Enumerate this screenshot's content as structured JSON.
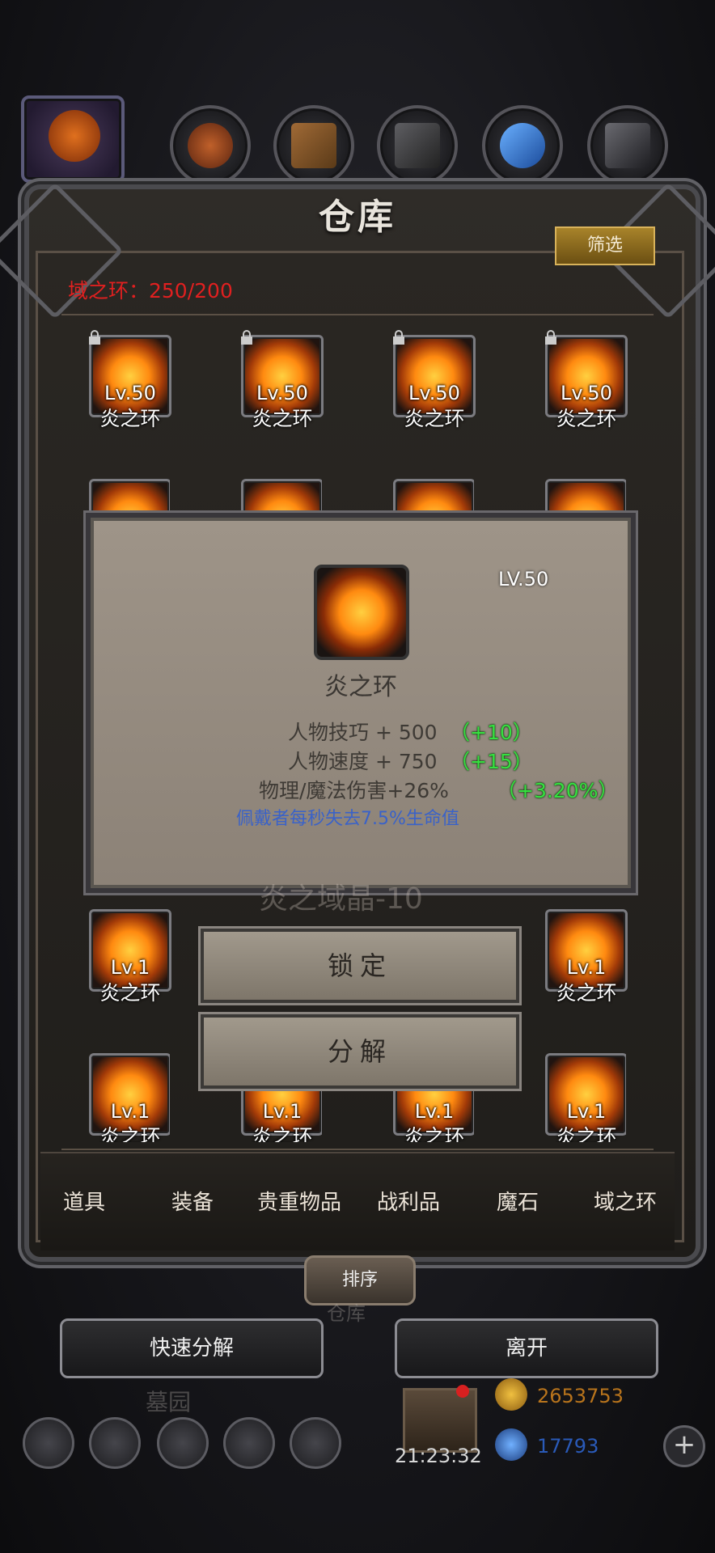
{
  "header": {
    "title": "仓库",
    "filter_label": "筛选",
    "count_label": "域之环：250/200"
  },
  "top_categories": [
    {
      "name": "pumpkin-category",
      "color": "#c0501a"
    },
    {
      "name": "potion-category",
      "color": "#9a4a20"
    },
    {
      "name": "wood-category",
      "color": "#8a5a2e"
    },
    {
      "name": "iron-category",
      "color": "#4a4a4a"
    },
    {
      "name": "crystal-category",
      "color": "#2a7ad0"
    },
    {
      "name": "ore-category",
      "color": "#5a5a5e"
    }
  ],
  "items_row1": [
    {
      "level": "Lv.50",
      "name": "炎之环",
      "locked": true
    },
    {
      "level": "Lv.50",
      "name": "炎之环",
      "locked": true
    },
    {
      "level": "Lv.50",
      "name": "炎之环",
      "locked": true
    },
    {
      "level": "Lv.50",
      "name": "炎之环",
      "locked": true
    }
  ],
  "items_row3": [
    {
      "level": "Lv.1",
      "name": "炎之环"
    },
    {
      "level": "Lv.1",
      "name": "炎之环"
    }
  ],
  "items_row4": [
    {
      "level": "Lv.1",
      "name": "炎之环"
    },
    {
      "level": "Lv.1",
      "name": "炎之环"
    },
    {
      "level": "Lv.1",
      "name": "炎之环"
    },
    {
      "level": "Lv.1",
      "name": "炎之环"
    }
  ],
  "popup": {
    "level": "LV.50",
    "item_name": "炎之环",
    "stats": [
      {
        "label": "人物技巧 + 500",
        "bonus": "（+10）"
      },
      {
        "label": "人物速度 + 750",
        "bonus": "（+15）"
      },
      {
        "label": "物理/魔法伤害+26%",
        "bonus": "（+3.20%）"
      }
    ],
    "effect": "佩戴者每秒失去7.5%生命值",
    "background_text": "炎之域晶-10"
  },
  "actions": {
    "lock_label": "锁定",
    "decompose_label": "分解"
  },
  "tabs": [
    "道具",
    "装备",
    "贵重物品",
    "战利品",
    "魔石",
    "域之环"
  ],
  "sort_label": "排序",
  "bottom_buttons": {
    "quick_decompose": "快速分解",
    "leave": "离开",
    "dim_warehouse": "仓库",
    "dim_graveyard": "墓园"
  },
  "status": {
    "time": "21:23:32",
    "gold": "2653753",
    "gems": "17793"
  },
  "colors": {
    "count_red": "#e02020",
    "bonus_green": "#36e040",
    "effect_blue": "#3a62c8",
    "gold_text": "#b8741c",
    "gem_text": "#2a5ab8"
  }
}
